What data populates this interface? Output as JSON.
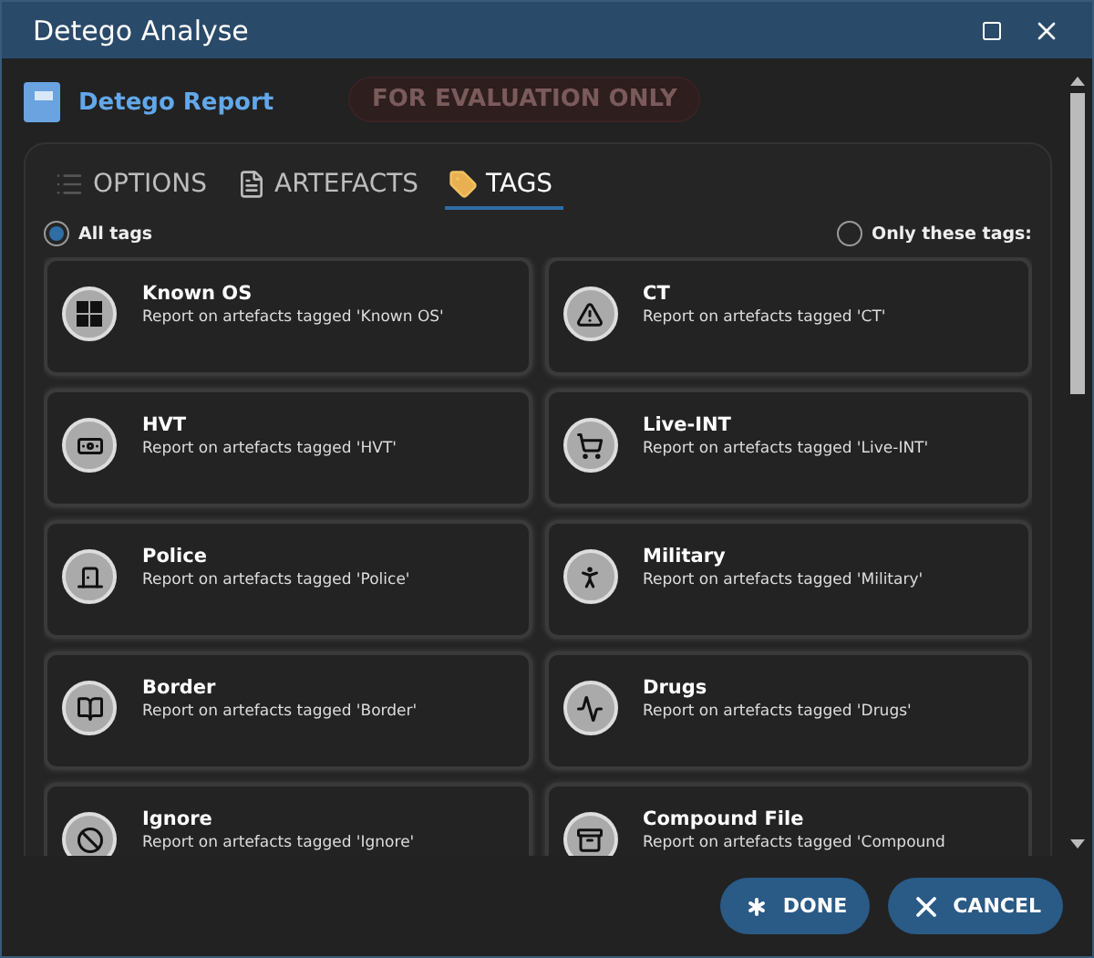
{
  "window": {
    "title": "Detego Analyse"
  },
  "header": {
    "title": "Detego Report",
    "banner": "FOR EVALUATION ONLY"
  },
  "tabs": [
    {
      "label": "OPTIONS",
      "selected": false
    },
    {
      "label": "ARTEFACTS",
      "selected": false
    },
    {
      "label": "TAGS",
      "selected": true
    }
  ],
  "filters": [
    {
      "label": "All tags",
      "selected": true
    },
    {
      "label": "Only these tags:",
      "selected": false
    }
  ],
  "tags": [
    {
      "name": "Known OS",
      "description": "Report on artefacts tagged 'Known OS'"
    },
    {
      "name": "CT",
      "description": "Report on artefacts tagged 'CT'"
    },
    {
      "name": "HVT",
      "description": "Report on artefacts tagged 'HVT'"
    },
    {
      "name": "Live-INT",
      "description": "Report on artefacts tagged 'Live-INT'"
    },
    {
      "name": "Police",
      "description": "Report on artefacts tagged 'Police'"
    },
    {
      "name": "Military",
      "description": "Report on artefacts tagged 'Military'"
    },
    {
      "name": "Border",
      "description": "Report on artefacts tagged 'Border'"
    },
    {
      "name": "Drugs",
      "description": "Report on artefacts tagged 'Drugs'"
    },
    {
      "name": "Ignore",
      "description": "Report on artefacts tagged 'Ignore'"
    },
    {
      "name": "Compound File",
      "description": "Report on artefacts tagged 'Compound"
    }
  ],
  "buttons": [
    {
      "label": "DONE",
      "kind": "done"
    },
    {
      "label": "CANCEL",
      "kind": "cancel"
    }
  ]
}
